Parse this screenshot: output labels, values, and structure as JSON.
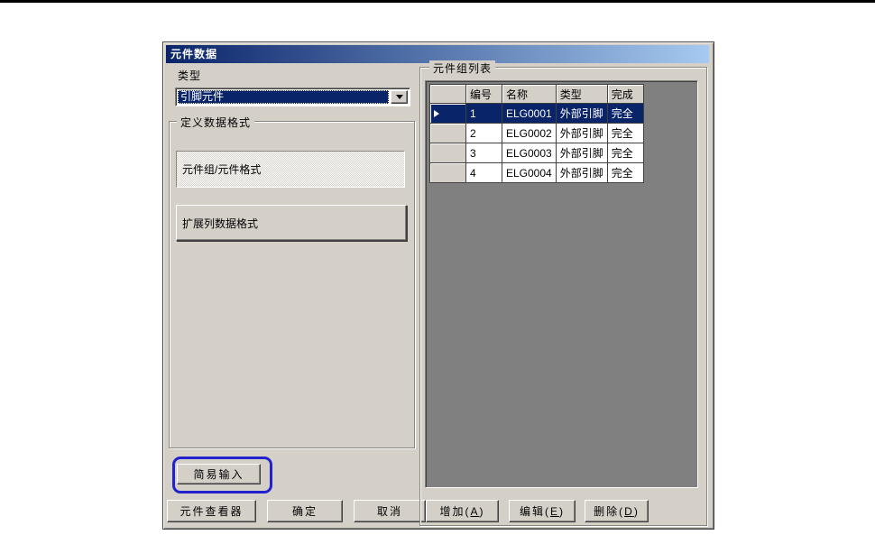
{
  "dialog": {
    "title": "元件数据",
    "colors": {
      "titlebar_left": "#0a246a",
      "titlebar_right": "#a6caf0",
      "face": "#d4d0c8",
      "selection": "#0a246a",
      "grid_background": "#808080",
      "annotation_blue": "#2222cc"
    },
    "type_label": "类型",
    "type_combo": {
      "value": "引脚元件"
    },
    "format_group": {
      "legend": "定义数据格式",
      "buttons": [
        {
          "label": "元件组/元件格式",
          "state": "selected"
        },
        {
          "label": "扩展列数据格式",
          "state": "normal"
        }
      ]
    },
    "easy_input_button": {
      "label": "简易输入",
      "highlighted": true
    },
    "left_buttons": {
      "viewer": "元件查看器",
      "ok": "确定",
      "cancel": "取消"
    },
    "list_group": {
      "legend": "元件组列表",
      "table": {
        "columns": [
          "",
          "编号",
          "名称",
          "类型",
          "完成"
        ],
        "rows": [
          {
            "num": "1",
            "name": "ELG0001",
            "type": "外部引脚",
            "done": "完全",
            "selected": true
          },
          {
            "num": "2",
            "name": "ELG0002",
            "type": "外部引脚",
            "done": "完全",
            "selected": false
          },
          {
            "num": "3",
            "name": "ELG0003",
            "type": "外部引脚",
            "done": "完全",
            "selected": false
          },
          {
            "num": "4",
            "name": "ELG0004",
            "type": "外部引脚",
            "done": "完全",
            "selected": false
          }
        ]
      },
      "buttons": {
        "add": {
          "pre": "增加(",
          "key": "A",
          "post": ")"
        },
        "edit": {
          "pre": "编辑(",
          "key": "E",
          "post": ")"
        },
        "delete": {
          "pre": "删除(",
          "key": "D",
          "post": ")"
        }
      }
    }
  }
}
